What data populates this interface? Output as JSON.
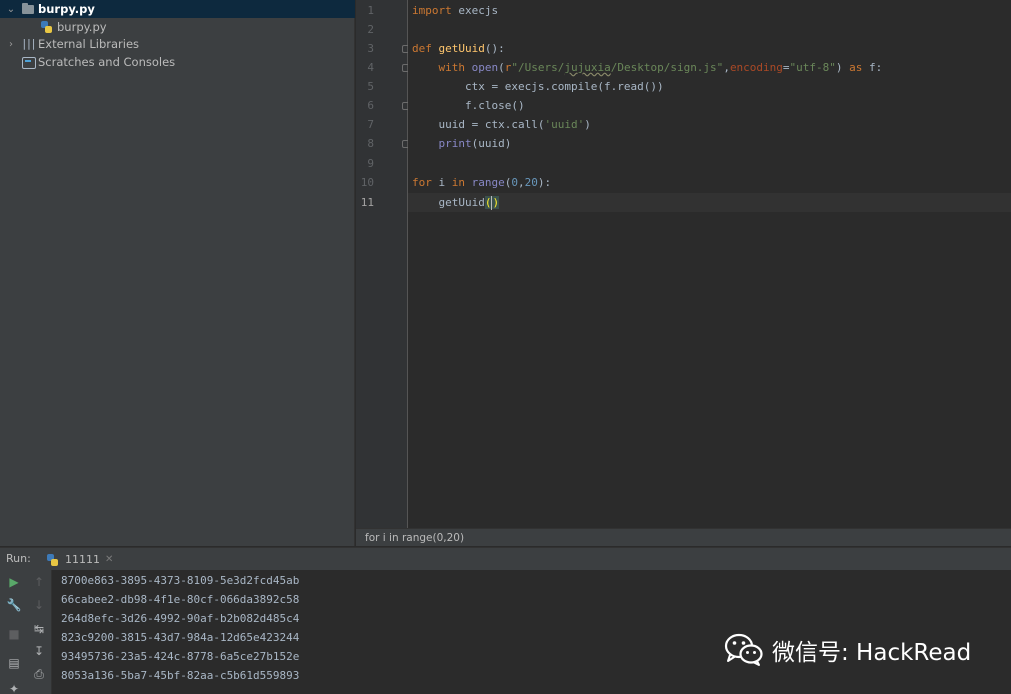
{
  "project_tree": {
    "items": [
      {
        "label": "burpy.py",
        "icon": "folder-icon",
        "expanded": true,
        "selected": true
      },
      {
        "label": "burpy.py",
        "icon": "python-file-icon"
      },
      {
        "label": "External Libraries",
        "icon": "library-icon",
        "expanded": false
      },
      {
        "label": "Scratches and Consoles",
        "icon": "scratches-icon"
      }
    ]
  },
  "editor": {
    "current_line": 11,
    "line_numbers": [
      "1",
      "2",
      "3",
      "4",
      "5",
      "6",
      "7",
      "8",
      "9",
      "10",
      "11"
    ],
    "lines": [
      "import execjs",
      "",
      "def getUuid():",
      "    with open(r\"/Users/jujuxia/Desktop/sign.js\",encoding=\"utf-8\") as f:",
      "        ctx = execjs.compile(f.read())",
      "        f.close()",
      "    uuid = ctx.call('uuid')",
      "    print(uuid)",
      "",
      "for i in range(0,20):",
      "    getUuid()"
    ]
  },
  "breadcrumb": {
    "text": "for i in range(0,20)"
  },
  "run_panel": {
    "title": "Run:",
    "tab_label": "11111",
    "output": [
      "8700e863-3895-4373-8109-5e3d2fcd45ab",
      "66cabee2-db98-4f1e-80cf-066da3892c58",
      "264d8efc-3d26-4992-90af-b2b082d485c4",
      "823c9200-3815-43d7-984a-12d65e423244",
      "93495736-23a5-424c-8778-6a5ce27b152e",
      "8053a136-5ba7-45bf-82aa-c5b61d559893"
    ]
  },
  "watermark": {
    "text": "微信号: HackRead",
    "icon": "wechat-icon"
  },
  "colors": {
    "background": "#2b2b2b",
    "panel": "#3c3f41",
    "keyword": "#cc7832",
    "function": "#ffc66d",
    "string": "#6a8759",
    "number": "#6897bb",
    "builtin": "#8888c6",
    "selection": "#0d293e"
  }
}
